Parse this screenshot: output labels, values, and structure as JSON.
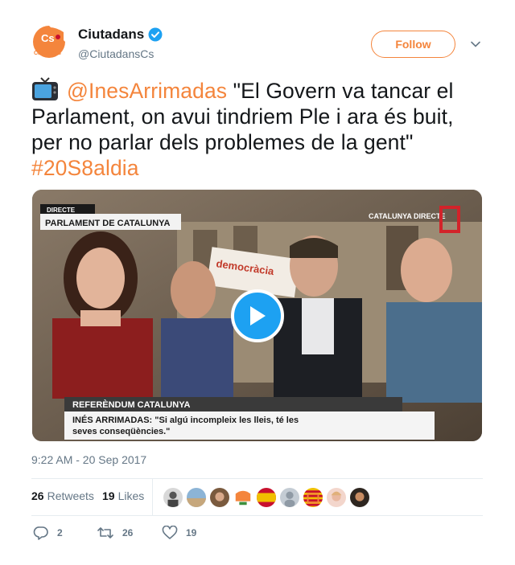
{
  "author": {
    "name": "Ciutadans",
    "handle": "@CiutadansCs",
    "avatar_text": "Ciutadans",
    "verified": true
  },
  "follow_label": "Follow",
  "tweet": {
    "mention": "@InesArrimadas",
    "body": " \"El Govern va tancar el Parlament, on avui tindriem Ple i ara és buit, per no parlar dels problemes de la gent\" ",
    "hashtag": "#20S8aldia",
    "emoji_icon": "tv-icon"
  },
  "media": {
    "top_bar_label": "DIRECTE",
    "location_label": "PARLAMENT DE CATALUNYA",
    "channel_label": "CATALUNYA DIRECTE",
    "lower_title": "REFERÈNDUM CATALUNYA",
    "quote_line1": "INÉS ARRIMADAS: \"Si algú incompleix les lleis, té les",
    "quote_line2": "seves conseqüències.\"",
    "sign_text": "democràcia"
  },
  "timestamp": "9:22 AM - 20 Sep 2017",
  "stats": {
    "retweets_count": "26",
    "retweets_label": "Retweets",
    "likes_count": "19",
    "likes_label": "Likes"
  },
  "actions": {
    "reply_count": "2",
    "retweet_count": "26",
    "like_count": "19"
  },
  "colors": {
    "accent": "#f4853c",
    "play": "#1da1f2",
    "muted": "#657786"
  }
}
